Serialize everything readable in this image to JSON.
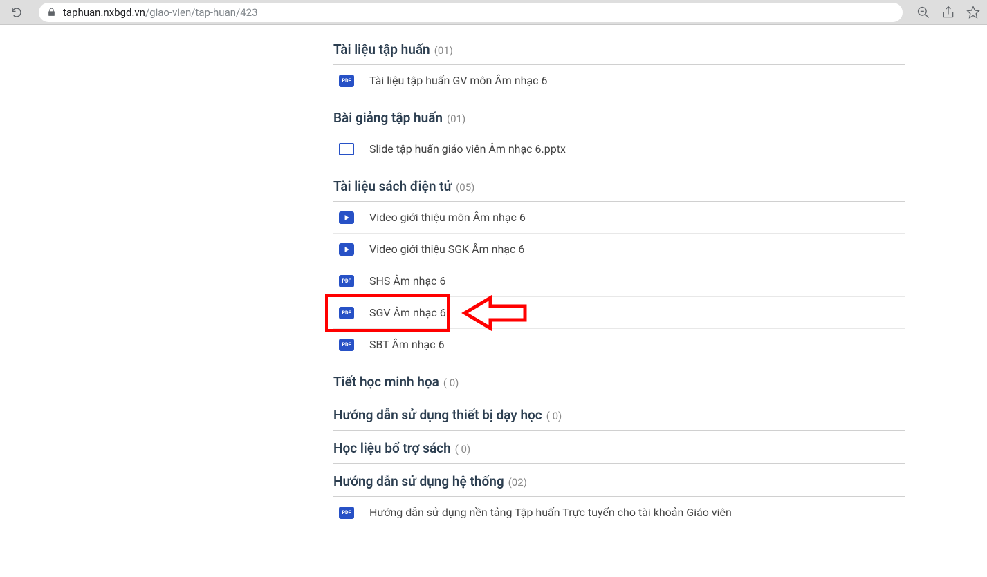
{
  "browser": {
    "url_domain": "taphuan.nxbgd.vn",
    "url_path": "/giao-vien/tap-huan/423"
  },
  "sections": [
    {
      "title": "Tài liệu tập huấn",
      "count": "(01)",
      "items": [
        {
          "icon": "pdf",
          "label": "Tài liệu tập huấn GV môn Âm nhạc 6"
        }
      ]
    },
    {
      "title": "Bài giảng tập huấn",
      "count": "(01)",
      "items": [
        {
          "icon": "slide",
          "label": "Slide tập huấn giáo viên Âm nhạc 6.pptx"
        }
      ]
    },
    {
      "title": "Tài liệu sách điện tử",
      "count": "(05)",
      "items": [
        {
          "icon": "video",
          "label": "Video giới thiệu môn Âm nhạc 6"
        },
        {
          "icon": "video",
          "label": "Video giới thiệu SGK Âm nhạc 6"
        },
        {
          "icon": "pdf",
          "label": "SHS Âm nhạc 6"
        },
        {
          "icon": "pdf",
          "label": "SGV Âm nhạc 6",
          "highlighted": true
        },
        {
          "icon": "pdf",
          "label": "SBT Âm nhạc 6"
        }
      ]
    },
    {
      "title": "Tiết học minh họa",
      "count": "( 0)",
      "items": []
    },
    {
      "title": "Hướng dẫn sử dụng thiết bị dạy học",
      "count": "( 0)",
      "items": []
    },
    {
      "title": "Học liệu bổ trợ sách",
      "count": "( 0)",
      "items": []
    },
    {
      "title": "Hướng dẫn sử dụng hệ thống",
      "count": "(02)",
      "items": [
        {
          "icon": "pdf",
          "label": "Hướng dẫn sử dụng nền tảng Tập huấn Trực tuyến cho tài khoản Giáo viên"
        }
      ]
    }
  ]
}
